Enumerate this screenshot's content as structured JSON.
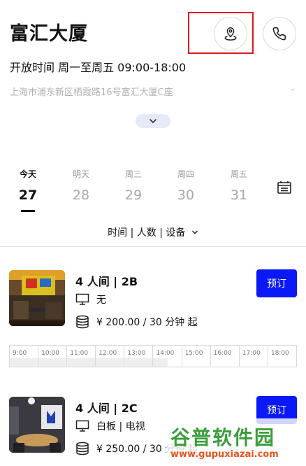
{
  "header": {
    "title": "富汇大厦",
    "hours": "开放时间 周一至周五 09:00-18:00",
    "address": "上海市浦东新区栖霞路16号富汇大厦C座",
    "address_more": "-"
  },
  "icons": {
    "map": "location-pin-icon",
    "phone": "phone-icon",
    "expand": "chevron-down-icon",
    "calendar": "calendar-icon"
  },
  "colors": {
    "accent": "#0a19f5",
    "highlight": "#e0191e",
    "expand_bg": "#e7e9fb"
  },
  "dates": [
    {
      "weekday": "今天",
      "day": "27",
      "active": true
    },
    {
      "weekday": "明天",
      "day": "28",
      "active": false
    },
    {
      "weekday": "周三",
      "day": "29",
      "active": false
    },
    {
      "weekday": "周四",
      "day": "30",
      "active": false
    },
    {
      "weekday": "周五",
      "day": "31",
      "active": false
    }
  ],
  "filter": {
    "label": "时间 | 人数 | 设备"
  },
  "rooms": [
    {
      "title": "4 人间 | 2B",
      "equipment": "无",
      "price": "¥ 200.00 / 30 分钟 起",
      "book_label": "预订"
    },
    {
      "title": "4 人间 | 2C",
      "equipment": "白板 | 电视",
      "price": "¥ 250.00 / 30 分钟 起",
      "book_label": "预订"
    }
  ],
  "timeline": [
    "9:00",
    "10:00",
    "11:00",
    "12:00",
    "13:00",
    "14:00",
    "15:00",
    "16:00",
    "17:00",
    "18:00"
  ],
  "watermark": {
    "big": "谷普软件园",
    "small": "www.gupuxiazai.com"
  }
}
